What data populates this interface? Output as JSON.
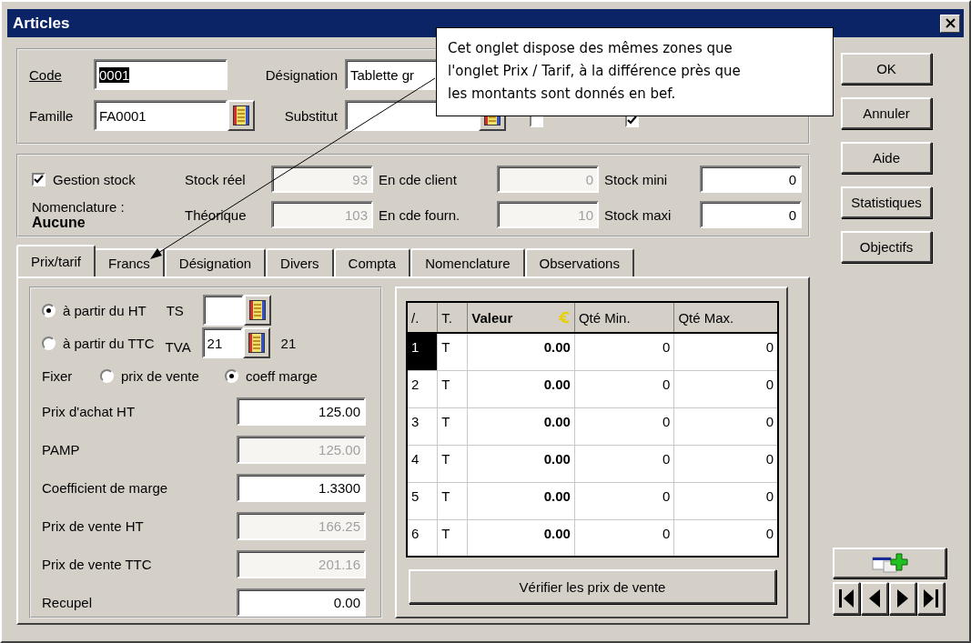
{
  "window": {
    "title": "Articles"
  },
  "header": {
    "code": {
      "label": "Code",
      "value": "0001",
      "underlined": true,
      "text_selected": true
    },
    "designation": {
      "label": "Désignation",
      "value": "Tablette gr"
    },
    "famille": {
      "label": "Famille",
      "value": "FA0001"
    },
    "substitut": {
      "label": "Substitut"
    },
    "checks": [
      {
        "checked": false
      },
      {
        "checked": true
      }
    ]
  },
  "stock": {
    "gestion": {
      "label": "Gestion stock",
      "checked": true
    },
    "nomenclature_label": "Nomenclature :",
    "nomenclature_value": "Aucune",
    "rows": [
      [
        {
          "label": "Stock réel",
          "value": "93",
          "disabled": true
        },
        {
          "label": "En cde client",
          "value": "0",
          "disabled": true
        },
        {
          "label": "Stock mini",
          "value": "0",
          "disabled": false
        }
      ],
      [
        {
          "label": "Théorique",
          "value": "103",
          "disabled": true
        },
        {
          "label": "En cde fourn.",
          "value": "10",
          "disabled": true
        },
        {
          "label": "Stock maxi",
          "value": "0",
          "disabled": false
        }
      ]
    ]
  },
  "tabs": [
    {
      "label": "Prix/tarif",
      "selected": true
    },
    {
      "label": "Francs",
      "selected": false
    },
    {
      "label": "Désignation",
      "selected": false
    },
    {
      "label": "Divers",
      "selected": false
    },
    {
      "label": "Compta",
      "selected": false
    },
    {
      "label": "Nomenclature",
      "selected": false
    },
    {
      "label": "Observations",
      "selected": false
    }
  ],
  "pricing": {
    "base": [
      {
        "label": "à partir du HT",
        "selected": true
      },
      {
        "label": "à partir du TTC",
        "selected": false
      }
    ],
    "ts": {
      "label": "TS"
    },
    "tva": {
      "label": "TVA",
      "value": "21",
      "rate": "21"
    },
    "fixer": {
      "label": "Fixer",
      "options": [
        {
          "label": "prix de vente",
          "selected": false
        },
        {
          "label": "coeff marge",
          "selected": true
        }
      ]
    },
    "fields": [
      {
        "label": "Prix d'achat HT",
        "value": "125.00",
        "disabled": false
      },
      {
        "label": "PAMP",
        "value": "125.00",
        "disabled": true
      },
      {
        "label": "Coefficient de marge",
        "value": "1.3300",
        "disabled": false
      },
      {
        "label": "Prix de vente HT",
        "value": "166.25",
        "disabled": true
      },
      {
        "label": "Prix de vente TTC",
        "value": "201.16",
        "disabled": true
      },
      {
        "label": "Recupel",
        "value": "0.00",
        "disabled": false
      }
    ]
  },
  "tiers": {
    "columns": [
      "/.",
      "T.",
      "Valeur",
      "Qté Min.",
      "Qté Max."
    ],
    "rows": [
      {
        "cells": [
          "1",
          "T",
          "0.00",
          "0",
          "0"
        ],
        "selected": true
      },
      {
        "cells": [
          "2",
          "T",
          "0.00",
          "0",
          "0"
        ],
        "selected": false
      },
      {
        "cells": [
          "3",
          "T",
          "0.00",
          "0",
          "0"
        ],
        "selected": false
      },
      {
        "cells": [
          "4",
          "T",
          "0.00",
          "0",
          "0"
        ],
        "selected": false
      },
      {
        "cells": [
          "5",
          "T",
          "0.00",
          "0",
          "0"
        ],
        "selected": false
      },
      {
        "cells": [
          "6",
          "T",
          "0.00",
          "0",
          "0"
        ],
        "selected": false
      }
    ],
    "button": "Vérifier les prix de vente"
  },
  "buttons": [
    "OK",
    "Annuler",
    "Aide",
    "Statistiques",
    "Objectifs"
  ],
  "callout": {
    "lines": [
      "Cet onglet dispose des mêmes zones que",
      "l'onglet Prix / Tarif, à la différence près que",
      "les montants sont donnés en bef."
    ]
  }
}
